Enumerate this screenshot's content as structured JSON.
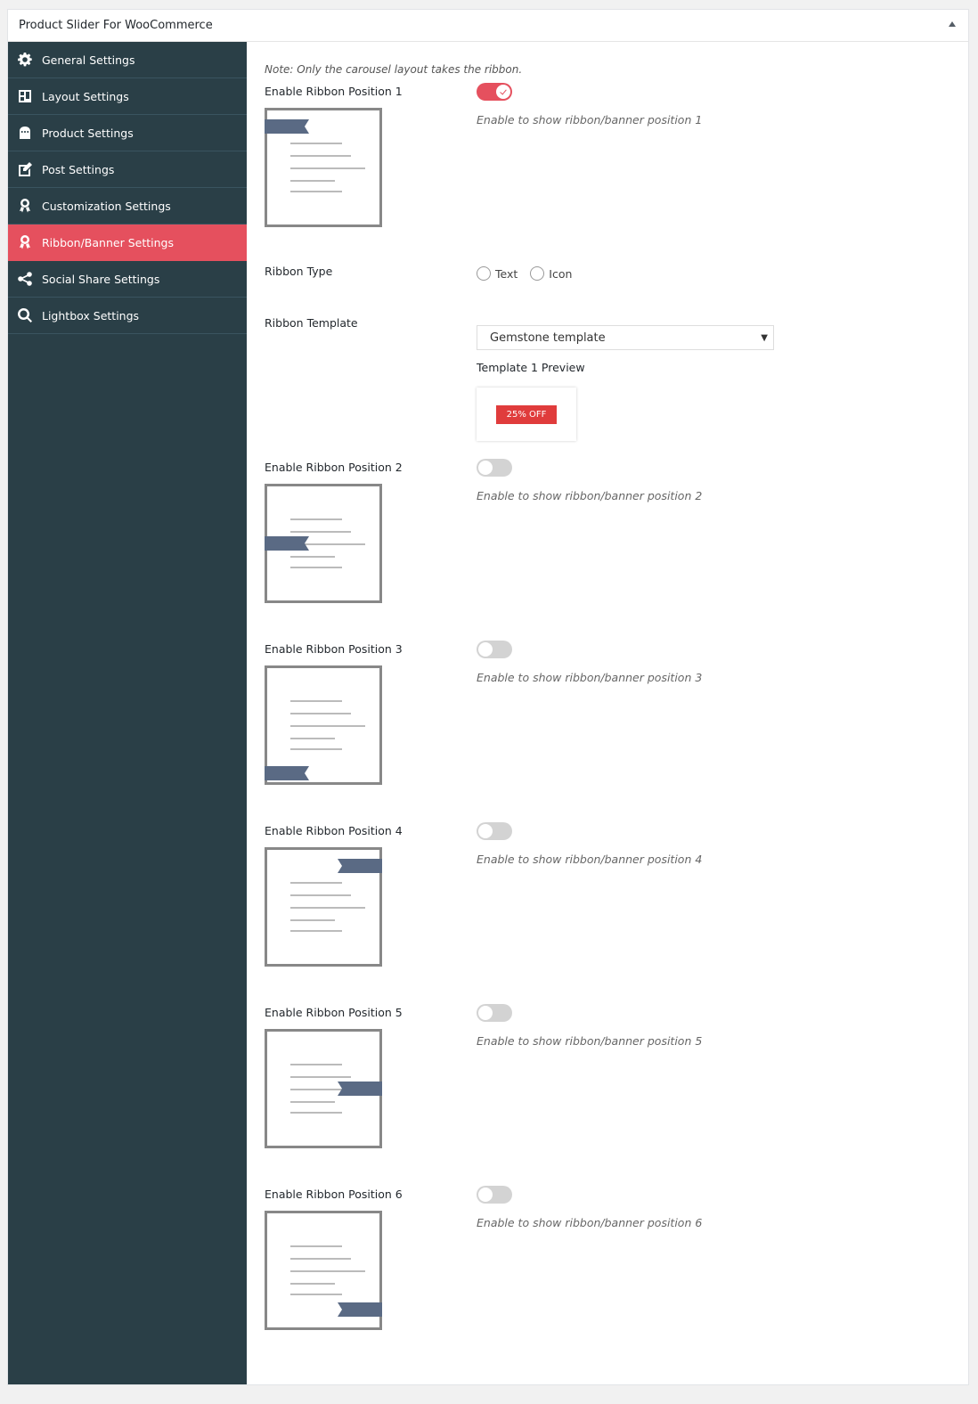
{
  "panel": {
    "title": "Product Slider For WooCommerce",
    "collapse_icon": "triangle-up-icon"
  },
  "sidebar": {
    "items": [
      {
        "label": "General Settings",
        "icon": "gear-icon",
        "active": false
      },
      {
        "label": "Layout Settings",
        "icon": "layout-icon",
        "active": false
      },
      {
        "label": "Product Settings",
        "icon": "shopping-bag-icon",
        "active": false
      },
      {
        "label": "Post Settings",
        "icon": "edit-icon",
        "active": false
      },
      {
        "label": "Customization Settings",
        "icon": "award-icon",
        "active": false
      },
      {
        "label": "Ribbon/Banner Settings",
        "icon": "award-icon",
        "active": true
      },
      {
        "label": "Social Share Settings",
        "icon": "share-icon",
        "active": false
      },
      {
        "label": "Lightbox Settings",
        "icon": "search-icon",
        "active": false
      }
    ]
  },
  "main": {
    "note": "Note: Only the carousel layout takes the ribbon.",
    "ribbon_type": {
      "label": "Ribbon Type",
      "options": [
        "Text",
        "Icon"
      ],
      "selected": null
    },
    "ribbon_template": {
      "label": "Ribbon Template",
      "value": "Gemstone template",
      "preview_label": "Template 1 Preview",
      "preview_badge": "25% OFF"
    },
    "positions": [
      {
        "label": "Enable Ribbon Position 1",
        "enabled": true,
        "help": "Enable to show ribbon/banner position 1"
      },
      {
        "label": "Enable Ribbon Position 2",
        "enabled": false,
        "help": "Enable to show ribbon/banner position 2"
      },
      {
        "label": "Enable Ribbon Position 3",
        "enabled": false,
        "help": "Enable to show ribbon/banner position 3"
      },
      {
        "label": "Enable Ribbon Position 4",
        "enabled": false,
        "help": "Enable to show ribbon/banner position 4"
      },
      {
        "label": "Enable Ribbon Position 5",
        "enabled": false,
        "help": "Enable to show ribbon/banner position 5"
      },
      {
        "label": "Enable Ribbon Position 6",
        "enabled": false,
        "help": "Enable to show ribbon/banner position 6"
      }
    ]
  },
  "colors": {
    "sidebar_bg": "#2a3f47",
    "accent": "#e5505e",
    "ribbon": "#5a6a84",
    "badge": "#e03c3c"
  }
}
